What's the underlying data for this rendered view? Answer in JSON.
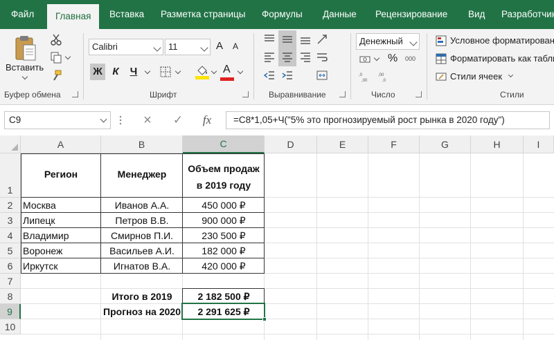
{
  "ribbon_tabs": [
    "Файл",
    "Главная",
    "Вставка",
    "Разметка страницы",
    "Формулы",
    "Данные",
    "Рецензирование",
    "Вид",
    "Разработчик"
  ],
  "active_tab": "Главная",
  "clipboard": {
    "paste_label": "Вставить",
    "group_label": "Буфер обмена"
  },
  "font": {
    "name": "Calibri",
    "size": "11",
    "bold": "Ж",
    "italic": "К",
    "underline": "Ч",
    "grow": "A",
    "shrink": "A",
    "font_color_letter": "A",
    "group_label": "Шрифт"
  },
  "alignment": {
    "group_label": "Выравнивание"
  },
  "number": {
    "format": "Денежный",
    "percent": "%",
    "group_label": "Число"
  },
  "styles": {
    "conditional": "Условное форматирование",
    "format_table": "Форматировать как таблицу",
    "cell_styles": "Стили ячеек",
    "group_label": "Стили"
  },
  "colors": {
    "excel_green": "#217346",
    "fill_yellow": "#ffe400",
    "font_red": "#e02020"
  },
  "formula_bar": {
    "name_box": "C9",
    "cancel_icon": "×",
    "enter_icon": "✓",
    "fx_label": "fx",
    "formula": "=C8*1,05+Ч(\"5% это прогнозируемый рост рынка в 2020 году\")"
  },
  "sheet": {
    "columns": [
      "A",
      "B",
      "C",
      "D",
      "E",
      "F",
      "G",
      "H",
      "I"
    ],
    "selected_column": "C",
    "selected_row": "9",
    "rows": [
      {
        "num": "1",
        "a": "Регион",
        "b": "Менеджер",
        "c": "Объем продаж\nв 2019 году"
      },
      {
        "num": "2",
        "a": "Москва",
        "b": "Иванов А.А.",
        "c": "450 000 ₽"
      },
      {
        "num": "3",
        "a": "Липецк",
        "b": "Петров В.В.",
        "c": "900 000 ₽"
      },
      {
        "num": "4",
        "a": "Владимир",
        "b": "Смирнов П.И.",
        "c": "230 500 ₽"
      },
      {
        "num": "5",
        "a": "Воронеж",
        "b": "Васильев А.И.",
        "c": "182 000 ₽"
      },
      {
        "num": "6",
        "a": "Иркутск",
        "b": "Игнатов В.А.",
        "c": "420 000 ₽"
      },
      {
        "num": "7",
        "a": "",
        "b": "",
        "c": ""
      },
      {
        "num": "8",
        "a": "",
        "b": "Итого в 2019",
        "c": "2 182 500 ₽"
      },
      {
        "num": "9",
        "a": "",
        "b": "Прогноз на 2020",
        "c": "2 291 625 ₽"
      },
      {
        "num": "10",
        "a": "",
        "b": "",
        "c": ""
      }
    ]
  }
}
